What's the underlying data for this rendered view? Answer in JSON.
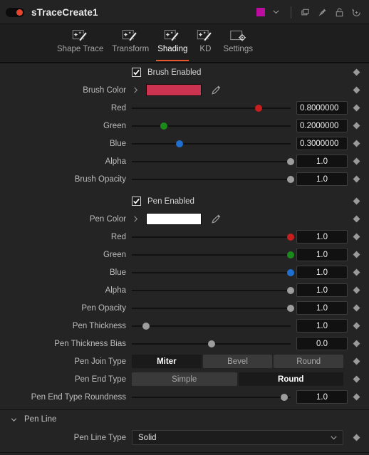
{
  "titlebar": {
    "node_name": "sTraceCreate1",
    "node_enabled_icon": "record-dot-icon",
    "color_chip": "#bd0d9e",
    "chip_chevron_icon": "chevron-down-icon",
    "icons": [
      "duplicate-icon",
      "pin-icon",
      "unlock-icon",
      "reset-history-icon"
    ]
  },
  "tabs": [
    {
      "label": "Shape Trace",
      "icon": "magic-wand-icon",
      "active": false,
      "clipped": true
    },
    {
      "label": "Transform",
      "icon": "magic-wand-icon",
      "active": false
    },
    {
      "label": "Shading",
      "icon": "magic-wand-icon",
      "active": true
    },
    {
      "label": "KD",
      "icon": "magic-wand-icon",
      "active": false
    },
    {
      "label": "Settings",
      "icon": "gear-screen-icon",
      "active": false
    }
  ],
  "accent": "#e8562c",
  "brush": {
    "enabled_label": "Brush Enabled",
    "enabled": true,
    "color_label": "Brush Color",
    "color_value": "#cc3350",
    "pipette_icon": "eyedropper-icon",
    "expand_icon": "chevron-right-icon",
    "channels": [
      {
        "label": "Red",
        "value": "0.8000000",
        "pct": 80,
        "knob": "#c81e1e"
      },
      {
        "label": "Green",
        "value": "0.2000000",
        "pct": 20,
        "knob": "#1a8a1a"
      },
      {
        "label": "Blue",
        "value": "0.3000000",
        "pct": 30,
        "knob": "#1f6fd0"
      }
    ],
    "alpha": {
      "label": "Alpha",
      "value": "1.0",
      "pct": 100,
      "knob": "#9d9d9d"
    },
    "opacity": {
      "label": "Brush Opacity",
      "value": "1.0",
      "pct": 100,
      "knob": "#9d9d9d"
    }
  },
  "pen": {
    "enabled_label": "Pen Enabled",
    "enabled": true,
    "color_label": "Pen Color",
    "color_value": "#ffffff",
    "pipette_icon": "eyedropper-icon",
    "expand_icon": "chevron-right-icon",
    "channels": [
      {
        "label": "Red",
        "value": "1.0",
        "pct": 100,
        "knob": "#c81e1e"
      },
      {
        "label": "Green",
        "value": "1.0",
        "pct": 100,
        "knob": "#1a8a1a"
      },
      {
        "label": "Blue",
        "value": "1.0",
        "pct": 100,
        "knob": "#1f6fd0"
      }
    ],
    "alpha": {
      "label": "Alpha",
      "value": "1.0",
      "pct": 100,
      "knob": "#9d9d9d"
    },
    "opacity": {
      "label": "Pen Opacity",
      "value": "1.0",
      "pct": 100,
      "knob": "#9d9d9d"
    },
    "thickness": {
      "label": "Pen Thickness",
      "value": "1.0",
      "pct": 9,
      "knob": "#9d9d9d"
    },
    "thickness_bias": {
      "label": "Pen Thickness Bias",
      "value": "0.0",
      "pct": 50,
      "knob": "#9d9d9d"
    },
    "join_type": {
      "label": "Pen Join Type",
      "options": [
        "Miter",
        "Bevel",
        "Round"
      ],
      "selected": "Miter"
    },
    "end_type": {
      "label": "Pen End Type",
      "options": [
        "Simple",
        "Round"
      ],
      "selected": "Round"
    },
    "end_roundness": {
      "label": "Pen End Type Roundness",
      "value": "1.0",
      "pct": 96,
      "knob": "#9d9d9d"
    }
  },
  "pen_line": {
    "group_title": "Pen Line",
    "group_chevron_icon": "chevron-down-icon",
    "type_label": "Pen Line Type",
    "type_value": "Solid",
    "type_chevron_icon": "chevron-down-icon"
  }
}
